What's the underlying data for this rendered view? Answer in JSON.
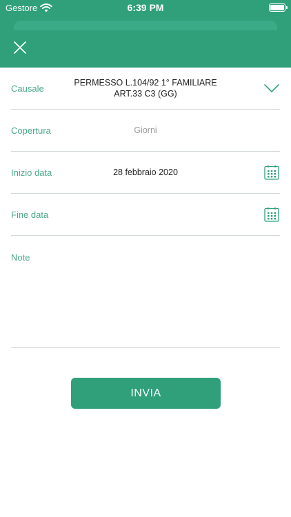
{
  "status_bar": {
    "carrier": "Gestore",
    "time": "6:39 PM",
    "icons": [
      "wifi-icon",
      "battery-icon"
    ]
  },
  "header": {
    "close_icon": "close-icon",
    "accent_color": "#2fa07a"
  },
  "form": {
    "causale": {
      "label": "Causale",
      "value_line1": "PERMESSO L.104/92 1° FAMILIARE",
      "value_line2": "ART.33 C3 (GG)",
      "icon": "chevron-down-icon"
    },
    "copertura": {
      "label": "Copertura",
      "value": "Giorni"
    },
    "inizio_data": {
      "label": "Inizio data",
      "value": "28 febbraio 2020",
      "icon": "calendar-icon"
    },
    "fine_data": {
      "label": "Fine data",
      "value": "",
      "icon": "calendar-icon"
    },
    "note": {
      "label": "Note",
      "value": ""
    }
  },
  "actions": {
    "submit_label": "INVIA"
  }
}
